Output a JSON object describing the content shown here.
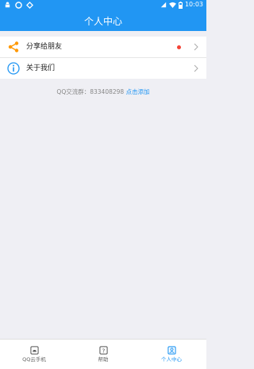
{
  "status_bar": {
    "time": "10:03",
    "icons": [
      "android-icon",
      "settings-circle-icon",
      "sync-icon",
      "signal-bars-icon",
      "wifi-icon",
      "battery-icon"
    ]
  },
  "header": {
    "title": "个人中心"
  },
  "menu": [
    {
      "label": "分享给朋友",
      "icon": "share-icon",
      "has_badge": true
    },
    {
      "label": "关于我们",
      "icon": "info-icon",
      "has_badge": false
    }
  ],
  "qq_group": {
    "text": "QQ交流群：833408298",
    "link": "点击添加"
  },
  "tabs": [
    {
      "label": "QQ云手机",
      "icon": "cloud-phone-icon",
      "active": false
    },
    {
      "label": "帮助",
      "icon": "help-icon",
      "active": false
    },
    {
      "label": "个人中心",
      "icon": "profile-icon",
      "active": true
    }
  ],
  "colors": {
    "primary": "#2196f3",
    "badge": "#f44336",
    "share_icon": "#ff9800",
    "background": "#efeff4"
  }
}
